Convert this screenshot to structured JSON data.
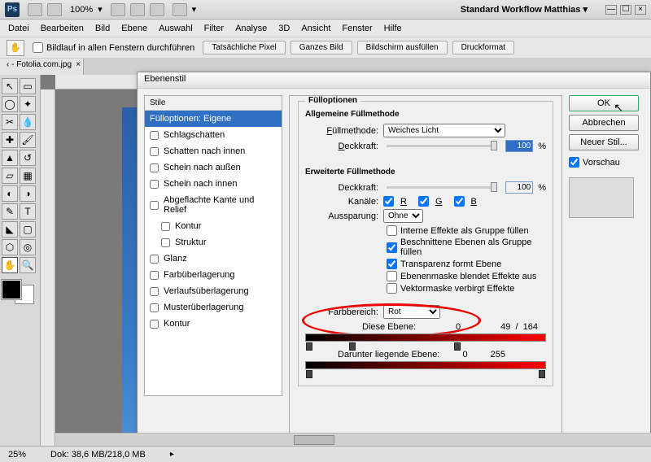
{
  "topbar": {
    "zoom": "100%",
    "workspace": "Standard Workflow Matthias"
  },
  "menus": [
    "Datei",
    "Bearbeiten",
    "Bild",
    "Ebene",
    "Auswahl",
    "Filter",
    "Analyse",
    "3D",
    "Ansicht",
    "Fenster",
    "Hilfe"
  ],
  "optbar": {
    "scroll_all": "Bildlauf in allen Fenstern durchführen",
    "btns": [
      "Tatsächliche Pixel",
      "Ganzes Bild",
      "Bildschirm ausfüllen",
      "Druckformat"
    ]
  },
  "filetab": "‹ - Fotolia.com.jpg",
  "dialog": {
    "title": "Ebenenstil",
    "styles_hdr": "Stile",
    "styles": [
      {
        "label": "Fülloptionen: Eigene",
        "sel": true
      },
      {
        "label": "Schlagschatten"
      },
      {
        "label": "Schatten nach innen"
      },
      {
        "label": "Schein nach außen"
      },
      {
        "label": "Schein nach innen"
      },
      {
        "label": "Abgeflachte Kante und Relief"
      },
      {
        "label": "Kontur",
        "indent": true
      },
      {
        "label": "Struktur",
        "indent": true
      },
      {
        "label": "Glanz"
      },
      {
        "label": "Farbüberlagerung"
      },
      {
        "label": "Verlaufsüberlagerung"
      },
      {
        "label": "Musterüberlagerung"
      },
      {
        "label": "Kontur"
      }
    ],
    "opts_title": "Fülloptionen",
    "general_title": "Allgemeine Füllmethode",
    "fullmethode_lbl": "Füllmethode:",
    "fullmethode_val": "Weiches Licht",
    "deckkraft_lbl": "Deckkraft:",
    "deckkraft_val": "100",
    "pct": "%",
    "adv_title": "Erweiterte Füllmethode",
    "deckkraft2_val": "100",
    "kanale_lbl": "Kanäle:",
    "ch_r": "R",
    "ch_g": "G",
    "ch_b": "B",
    "aussparung_lbl": "Aussparung:",
    "aussparung_val": "Ohne",
    "adv_checks": [
      {
        "label": "Interne Effekte als Gruppe füllen",
        "on": false
      },
      {
        "label": "Beschnittene Ebenen als Gruppe füllen",
        "on": true
      },
      {
        "label": "Transparenz formt Ebene",
        "on": true
      },
      {
        "label": "Ebenenmaske blendet Effekte aus",
        "on": false
      },
      {
        "label": "Vektormaske verbirgt Effekte",
        "on": false
      }
    ],
    "farbbereich_lbl": "Farbbereich:",
    "farbbereich_val": "Rot",
    "this_layer_lbl": "Diese Ebene:",
    "this_layer_a": "0",
    "this_layer_b": "49",
    "this_layer_c": "164",
    "below_lbl": "Darunter liegende Ebene:",
    "below_a": "0",
    "below_b": "255",
    "btn_ok": "OK",
    "btn_cancel": "Abbrechen",
    "btn_new": "Neuer Stil...",
    "preview": "Vorschau"
  },
  "status": {
    "zoom": "25%",
    "doc": "Dok: 38,6 MB/218,0 MB"
  }
}
